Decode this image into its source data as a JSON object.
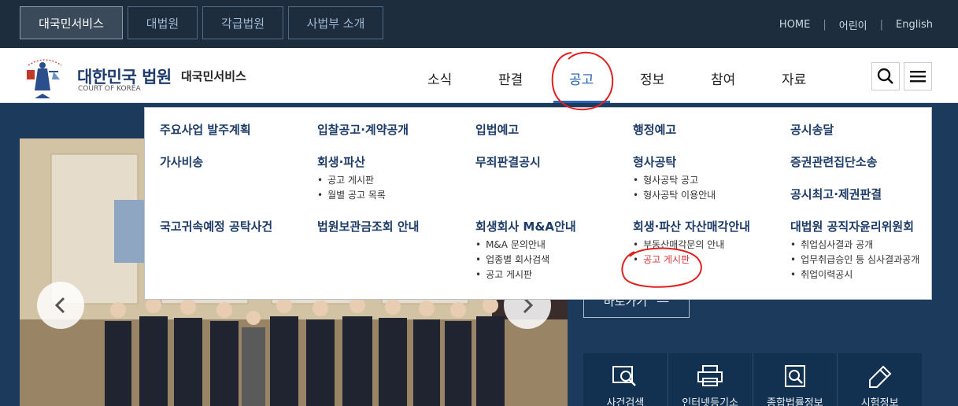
{
  "top_tabs": [
    "대국민서비스",
    "대법원",
    "각급법원",
    "사법부 소개"
  ],
  "top_links": [
    "HOME",
    "어린이",
    "English"
  ],
  "brand": {
    "title_ko": "대한민국 법원",
    "title_en": "COURT OF KOREA",
    "sub": "대국민서비스"
  },
  "gnb": [
    "소식",
    "판결",
    "공고",
    "정보",
    "참여",
    "자료"
  ],
  "dropdown": {
    "col1": {
      "h1": "주요사업 발주계획",
      "h2": "가사비송",
      "h3": "국고귀속예정 공탁사건"
    },
    "col2": {
      "h1": "입찰공고·계약공개",
      "h2": "회생·파산",
      "h2_subs": [
        "공고 게시판",
        "월별 공고 목록"
      ],
      "h3": "법원보관금조회 안내"
    },
    "col3": {
      "h1": "입법예고",
      "h2": "무죄판결공시",
      "h3": "회생회사 M&A안내",
      "h3_subs": [
        "M&A 문의안내",
        "업종별 회사검색",
        "공고 게시판"
      ]
    },
    "col4": {
      "h1": "행정예고",
      "h2": "형사공탁",
      "h2_subs": [
        "형사공탁 공고",
        "형사공탁 이용안내"
      ],
      "h3": "회생·파산 자산매각안내",
      "h3_subs": [
        "부동산매각문의 안내",
        "공고 게시판"
      ]
    },
    "col5": {
      "h1": "공시송달",
      "h2": "증권관련집단소송",
      "h2b": "공시최고·제권판결",
      "h3": "대법원 공직자윤리위원회",
      "h3_subs": [
        "취업심사결과 공개",
        "업무취급승인 등 심사결과공개",
        "취업이력공시"
      ]
    }
  },
  "hero": {
    "shortcut": "바로가기"
  },
  "quick_menu": [
    "사건검색",
    "인터넷등기소",
    "종합법률정보",
    "시험정보"
  ],
  "colors": {
    "navy": "#1d2d3d",
    "brand": "#1f3c6e",
    "accent": "#2b63b8",
    "annotation": "#e02020"
  }
}
